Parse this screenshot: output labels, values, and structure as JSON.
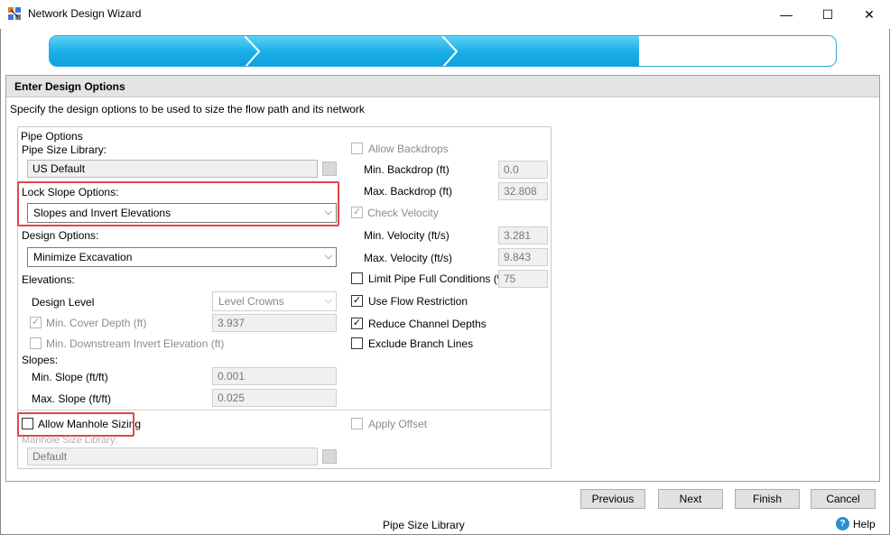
{
  "window": {
    "title": "Network Design Wizard",
    "minimize_glyph": "—",
    "maximize_glyph": "☐",
    "close_glyph": "✕",
    "app_icon": "network-wizard-icon"
  },
  "progress": {
    "steps_total": 4,
    "steps_completed": 3,
    "fraction": 0.75,
    "color": "#17aee6"
  },
  "panel": {
    "title": "Enter Design Options",
    "instructions": "Specify the design options to be used to size the flow path and its network"
  },
  "pipe_options": {
    "group_label": "Pipe Options",
    "pipe_size_library_label": "Pipe Size Library:",
    "pipe_size_library_value": "US Default",
    "lock_slope_label": "Lock Slope Options:",
    "lock_slope_value": "Slopes and Invert Elevations",
    "design_options_label": "Design Options:",
    "design_options_value": "Minimize Excavation",
    "elevations_label": "Elevations:",
    "design_level_label": "Design Level",
    "design_level_value": "Level Crowns",
    "min_cover_label": "Min. Cover Depth (ft)",
    "min_cover_value": "3.937",
    "min_downstream_label": "Min. Downstream Invert Elevation (ft)",
    "slopes_label": "Slopes:",
    "min_slope_label": "Min. Slope (ft/ft)",
    "min_slope_value": "0.001",
    "max_slope_label": "Max. Slope (ft/ft)",
    "max_slope_value": "0.025"
  },
  "right_options": {
    "allow_backdrops_label": "Allow Backdrops",
    "min_backdrop_label": "Min. Backdrop (ft)",
    "min_backdrop_value": "0.0",
    "max_backdrop_label": "Max. Backdrop (ft)",
    "max_backdrop_value": "32.808",
    "check_velocity_label": "Check Velocity",
    "min_velocity_label": "Min. Velocity (ft/s)",
    "min_velocity_value": "3.281",
    "max_velocity_label": "Max. Velocity (ft/s)",
    "max_velocity_value": "9.843",
    "limit_pipe_full_label": "Limit Pipe Full Conditions (%)",
    "limit_pipe_full_value": "75",
    "use_flow_restriction_label": "Use Flow Restriction",
    "reduce_channel_depths_label": "Reduce Channel Depths",
    "exclude_branch_lines_label": "Exclude Branch Lines",
    "apply_offset_label": "Apply Offset"
  },
  "checks": {
    "allow_backdrops": false,
    "check_velocity": true,
    "min_cover": true,
    "min_downstream": false,
    "limit_pipe_full": false,
    "use_flow_restriction": true,
    "reduce_channel_depths": true,
    "exclude_branch_lines": false,
    "allow_manhole_sizing": false,
    "apply_offset": false
  },
  "manhole": {
    "allow_manhole_sizing_label": "Allow Manhole Sizing",
    "manhole_size_library_label": "Manhole Size Library:",
    "manhole_size_library_value": "Default"
  },
  "footer": {
    "previous_label": "Previous",
    "next_label": "Next",
    "finish_label": "Finish",
    "cancel_label": "Cancel",
    "status_text": "Pipe Size Library",
    "help_label": "Help",
    "help_glyph": "?"
  },
  "glyphs": {
    "check": "✓",
    "dropdown": "⌵"
  },
  "colors": {
    "highlight": "#e04646",
    "accent": "#17aee6"
  }
}
